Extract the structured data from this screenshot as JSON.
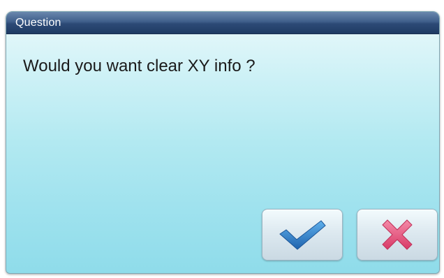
{
  "dialog": {
    "title": "Question",
    "message": "Would you want clear XY info ?"
  },
  "buttons": {
    "confirm_icon": "check-icon",
    "cancel_icon": "close-icon"
  },
  "colors": {
    "title_bar": "#2c4a76",
    "dialog_body": "#b2e9f1",
    "check": "#2f7fc8",
    "cross": "#e6507a"
  }
}
